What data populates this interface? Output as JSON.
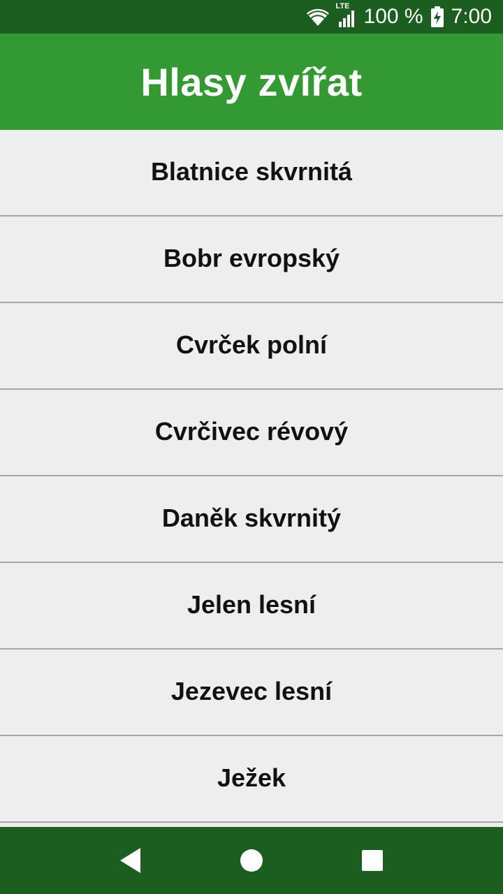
{
  "status_bar": {
    "network": "LTE",
    "battery": "100 %",
    "time": "7:00"
  },
  "app_bar": {
    "title": "Hlasy zvířat"
  },
  "list": {
    "items": [
      "Blatnice skvrnitá",
      "Bobr evropský",
      "Cvrček polní",
      "Cvrčivec révový",
      "Daněk skvrnitý",
      "Jelen lesní",
      "Jezevec lesní",
      "Ježek"
    ]
  },
  "nav_bar": {
    "icons": [
      "back-icon",
      "home-icon",
      "recents-icon"
    ]
  },
  "colors": {
    "status_bar": "#1b5e20",
    "app_bar": "#339933",
    "list_bg": "#eeeeee",
    "divider": "#a6a6a6"
  }
}
